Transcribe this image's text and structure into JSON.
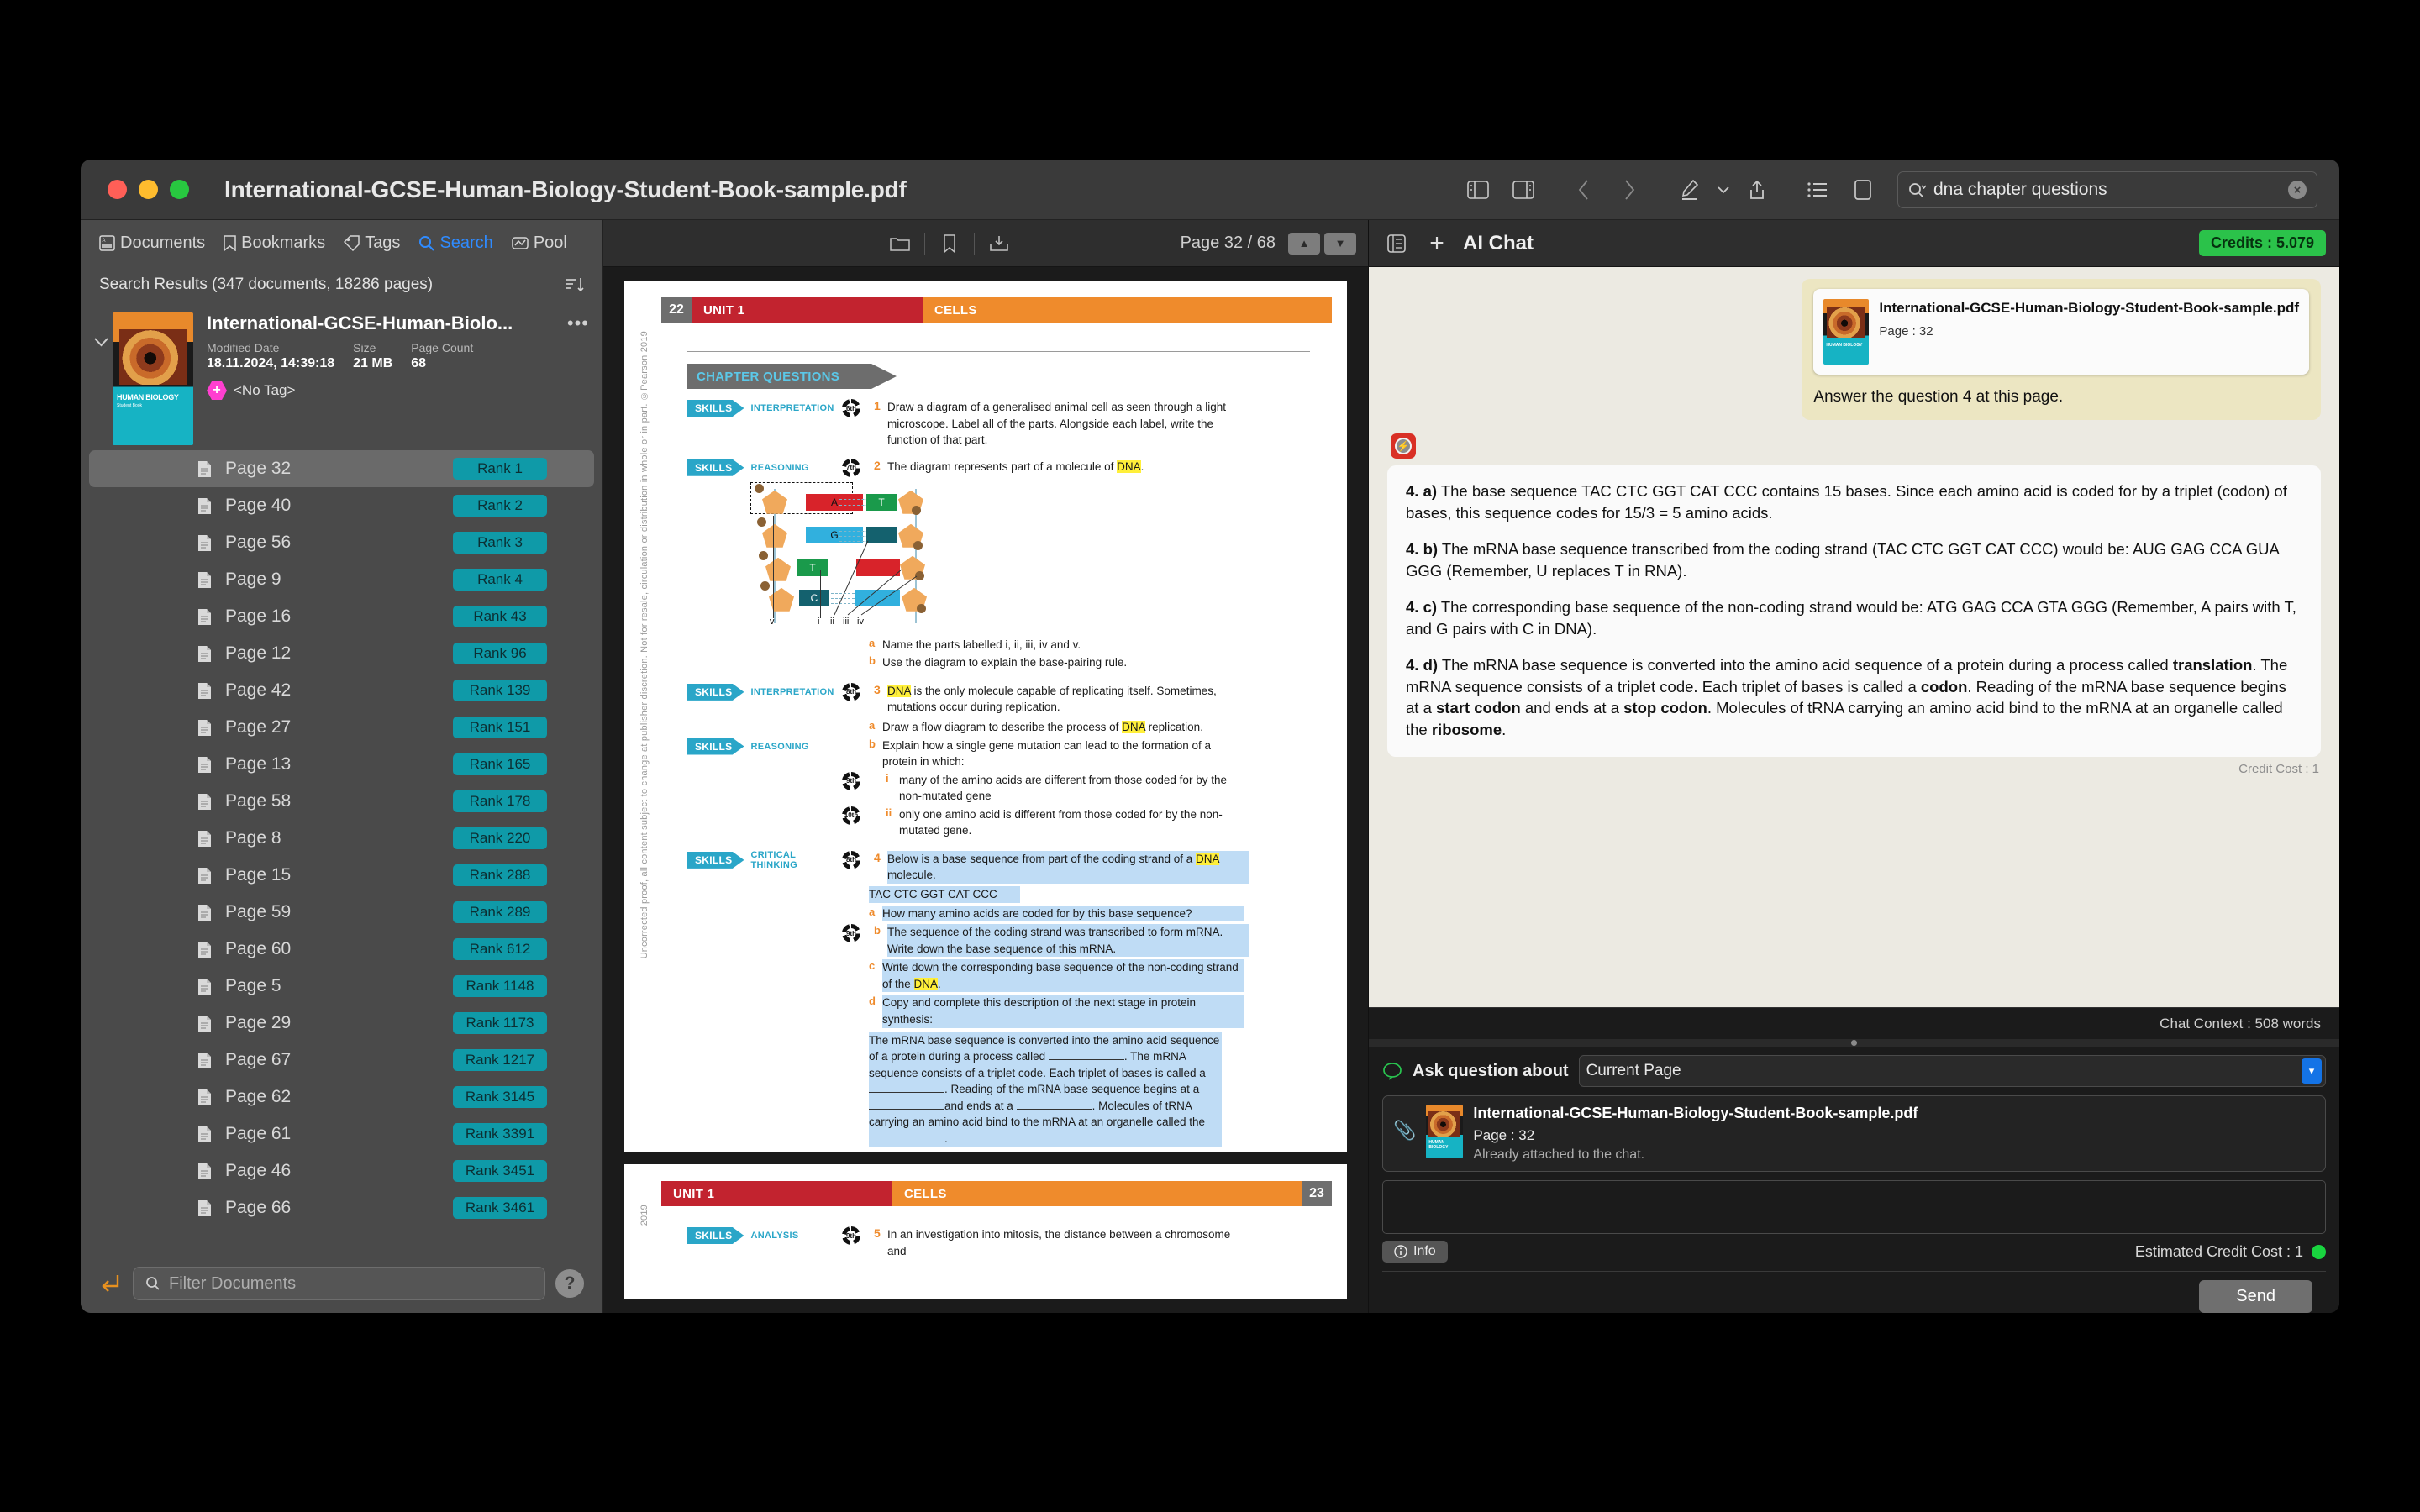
{
  "window": {
    "title": "International-GCSE-Human-Biology-Student-Book-sample.pdf"
  },
  "toolbar": {
    "sidebar_left_icon": "sidebar-left-icon",
    "sidebar_right_icon": "sidebar-right-icon",
    "back_icon": "chevron-left-icon",
    "forward_icon": "chevron-right-icon",
    "markup_icon": "pen-icon",
    "markup_caret": "chevron-down-icon",
    "share_icon": "share-icon",
    "list_icon": "list-icon",
    "panel_icon": "panel-icon",
    "search_value": "dna chapter questions",
    "search_clear": "×"
  },
  "sidebar": {
    "tabs": [
      {
        "label": "Documents",
        "icon": "documents-icon",
        "active": false
      },
      {
        "label": "Bookmarks",
        "icon": "bookmark-icon",
        "active": false
      },
      {
        "label": "Tags",
        "icon": "tag-icon",
        "active": false
      },
      {
        "label": "Search",
        "icon": "search-icon",
        "active": true
      },
      {
        "label": "Pool",
        "icon": "pool-icon",
        "active": false
      }
    ],
    "results_header": "Search Results (347 documents, 18286 pages)",
    "sort_icon": "sort-descending-icon",
    "document": {
      "name": "International-GCSE-Human-Biolo...",
      "cover_title": "HUMAN BIOLOGY",
      "cover_sub": "Student Book",
      "modified_label": "Modified Date",
      "modified_value": "18.11.2024, 14:39:18",
      "size_label": "Size",
      "size_value": "21 MB",
      "pagecount_label": "Page Count",
      "pagecount_value": "68",
      "tag": "<No Tag>",
      "more": "•••"
    },
    "pages": [
      {
        "page": "Page 32",
        "rank": "Rank 1",
        "selected": true
      },
      {
        "page": "Page 40",
        "rank": "Rank 2",
        "selected": false
      },
      {
        "page": "Page 56",
        "rank": "Rank 3",
        "selected": false
      },
      {
        "page": "Page 9",
        "rank": "Rank 4",
        "selected": false
      },
      {
        "page": "Page 16",
        "rank": "Rank 43",
        "selected": false
      },
      {
        "page": "Page 12",
        "rank": "Rank 96",
        "selected": false
      },
      {
        "page": "Page 42",
        "rank": "Rank 139",
        "selected": false
      },
      {
        "page": "Page 27",
        "rank": "Rank 151",
        "selected": false
      },
      {
        "page": "Page 13",
        "rank": "Rank 165",
        "selected": false
      },
      {
        "page": "Page 58",
        "rank": "Rank 178",
        "selected": false
      },
      {
        "page": "Page 8",
        "rank": "Rank 220",
        "selected": false
      },
      {
        "page": "Page 15",
        "rank": "Rank 288",
        "selected": false
      },
      {
        "page": "Page 59",
        "rank": "Rank 289",
        "selected": false
      },
      {
        "page": "Page 60",
        "rank": "Rank 612",
        "selected": false
      },
      {
        "page": "Page 5",
        "rank": "Rank 1148",
        "selected": false
      },
      {
        "page": "Page 29",
        "rank": "Rank 1173",
        "selected": false
      },
      {
        "page": "Page 67",
        "rank": "Rank 1217",
        "selected": false
      },
      {
        "page": "Page 62",
        "rank": "Rank 3145",
        "selected": false
      },
      {
        "page": "Page 61",
        "rank": "Rank 3391",
        "selected": false
      },
      {
        "page": "Page 46",
        "rank": "Rank 3451",
        "selected": false
      },
      {
        "page": "Page 66",
        "rank": "Rank 3461",
        "selected": false
      }
    ],
    "filter_placeholder": "Filter Documents",
    "help": "?"
  },
  "pdf": {
    "toolbar": {
      "folder_icon": "folder-icon",
      "bookmark_icon": "bookmark-icon",
      "download_icon": "download-icon",
      "page_indicator": "Page 32 / 68",
      "up": "▲",
      "down": "▼"
    },
    "page32": {
      "copyright": "Uncorrected proof, all content subject to change at publisher discretion. Not for resale, circulation or distribution in whole or in part. ©Pearson 2019",
      "band_number": "22",
      "band_unit": "UNIT 1",
      "band_section": "CELLS",
      "chapter_questions": "CHAPTER QUESTIONS",
      "q1": {
        "skills": "SKILLS",
        "skill_name": "INTERPRETATION",
        "clock": "6th",
        "num": "1",
        "text": "Draw a diagram of a generalised animal cell as seen through a light microscope. Label all of the parts. Alongside each label, write the function of that part."
      },
      "q2": {
        "skills": "SKILLS",
        "skill_name": "REASONING",
        "clock": "7th",
        "num": "2",
        "text_pre": "The diagram represents part of a molecule of ",
        "text_hl": "DNA",
        "text_post": ".",
        "sub_a_lbl": "a",
        "sub_a": "Name the parts labelled i, ii, iii, iv and v.",
        "sub_b_lbl": "b",
        "sub_b": "Use the diagram to explain the base-pairing rule."
      },
      "diagram": {
        "bases_left": [
          "A",
          "G",
          "T",
          "C"
        ],
        "bases_right": [
          "T",
          "",
          "",
          ""
        ],
        "labels": [
          "v",
          "i",
          "ii",
          "iii",
          "iv"
        ]
      },
      "q3": {
        "skills": "SKILLS",
        "skill_name": "INTERPRETATION",
        "skill_name2": "REASONING",
        "clock": "8th",
        "clock_i": "9th",
        "clock_ii": "10th",
        "num": "3",
        "text_hl": "DNA",
        "text": " is the only molecule capable of replicating itself. Sometimes, mutations occur during replication.",
        "sub_a_lbl": "a",
        "sub_a_pre": "Draw a flow diagram to describe the process of ",
        "sub_a_hl": "DNA",
        "sub_a_post": " replication.",
        "sub_b_lbl": "b",
        "sub_b": "Explain how a single gene mutation can lead to the formation of a protein in which:",
        "sub_i_lbl": "i",
        "sub_i": "many of the amino acids are different from those coded for by the non-mutated gene",
        "sub_ii_lbl": "ii",
        "sub_ii": "only one amino acid is different from those coded for by the non-mutated gene."
      },
      "q4": {
        "skills": "SKILLS",
        "skill_name": "CRITICAL THINKING",
        "clock": "8th",
        "clock_b": "9th",
        "num": "4",
        "text_pre": "Below is a base sequence from part of the coding strand of a ",
        "text_hl": "DNA",
        "text_post": " molecule.",
        "sequence": "TAC CTC GGT CAT CCC",
        "sub_a_lbl": "a",
        "sub_a": "How many amino acids are coded for by this base sequence?",
        "sub_b_lbl": "b",
        "sub_b": "The sequence of the coding strand was transcribed to form mRNA. Write down the base sequence of this mRNA.",
        "sub_c_lbl": "c",
        "sub_c_pre": "Write down the corresponding base sequence of the non-coding strand of the ",
        "sub_c_hl": "DNA",
        "sub_c_post": ".",
        "sub_d_lbl": "d",
        "sub_d": "Copy and complete this description of the next stage in protein synthesis:",
        "blank_para_1": "The mRNA base sequence is converted into the amino acid sequence of a protein during a process called",
        "blank_para_2": ". The mRNA sequence consists of a triplet code. Each triplet of bases is called a",
        "blank_para_3": ". Reading of the mRNA base sequence begins at a",
        "blank_para_4": "and ends at a",
        "blank_para_5": ". Molecules of tRNA carrying an amino acid bind to the mRNA at an organelle called the",
        "blank_para_6": "."
      }
    },
    "page33": {
      "copyright": "2019",
      "band_unit": "UNIT 1",
      "band_section": "CELLS",
      "band_number": "23",
      "q5": {
        "skills": "SKILLS",
        "skill_name": "ANALYSIS",
        "clock": "9th",
        "num": "5",
        "text": "In an investigation into mitosis, the distance between a chromosome and"
      }
    }
  },
  "chat": {
    "panel_icon": "chat-panel-icon",
    "add_icon": "+",
    "title": "AI Chat",
    "credits": "Credits : 5.079",
    "user_message": {
      "attachment_name": "International-GCSE-Human-Biology-Student-Book-sample.pdf",
      "attachment_page": "Page : 32",
      "text": "Answer the question 4 at this page."
    },
    "ai_avatar": "ai-assistant-icon",
    "answers": [
      {
        "label": "4. a)",
        "text": " The base sequence TAC CTC GGT CAT CCC contains 15 bases. Since each amino acid is coded for by a triplet (codon) of bases, this sequence codes for 15/3 = 5 amino acids."
      },
      {
        "label": "4. b)",
        "text": " The mRNA base sequence transcribed from the coding strand (TAC CTC GGT CAT CCC) would be: AUG GAG CCA GUA GGG (Remember, U replaces T in RNA)."
      },
      {
        "label": "4. c)",
        "text": " The corresponding base sequence of the non-coding strand would be: ATG GAG CCA GTA GGG (Remember, A pairs with T, and G pairs with C in DNA)."
      }
    ],
    "answer_d": {
      "label": "4. d)",
      "t1": " The mRNA base sequence is converted into the amino acid sequence of a protein during a process called ",
      "b1": "translation",
      "t2": ". The mRNA sequence consists of a triplet code. Each triplet of bases is called a ",
      "b2": "codon",
      "t3": ". Reading of the mRNA base sequence begins at a ",
      "b3": "start codon",
      "t4": " and ends at a ",
      "b4": "stop codon",
      "t5": ". Molecules of tRNA carrying an amino acid bind to the mRNA at an organelle called the ",
      "b5": "ribosome",
      "t6": "."
    },
    "credit_cost": "Credit Cost : 1",
    "chat_context": "Chat Context : 508 words",
    "ask_label": "Ask question about",
    "ask_value": "Current Page",
    "attached": {
      "name": "International-GCSE-Human-Biology-Student-Book-sample.pdf",
      "page": "Page : 32",
      "status": "Already attached to the chat."
    },
    "info_label": "Info",
    "estimated_cost": "Estimated Credit Cost : 1",
    "send_label": "Send"
  },
  "colors": {
    "accent_blue": "#2f8bff",
    "rank_teal": "#0f9aa8",
    "credits_green": "#2bc24a",
    "unit_red": "#c2232f",
    "cells_orange": "#ef8b2c",
    "skills_blue": "#2aa6c8",
    "highlight_yellow": "#ffef3a",
    "highlight_blue": "#bfdcf5"
  }
}
